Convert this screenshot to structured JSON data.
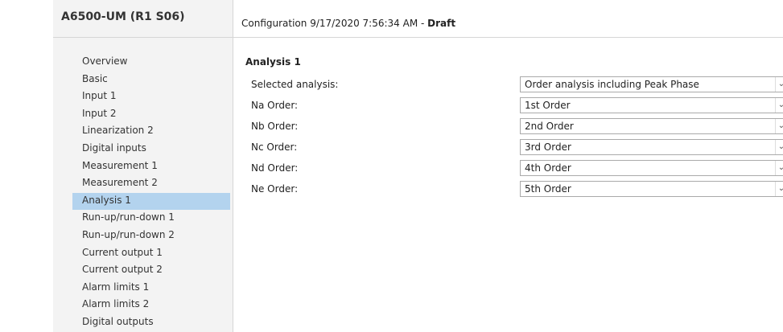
{
  "device": {
    "title": "A6500-UM (R1 S06)"
  },
  "header": {
    "prefix": "Configuration 9/17/2020 7:56:34 AM - ",
    "status": "Draft"
  },
  "nav": {
    "items": [
      {
        "label": "Overview"
      },
      {
        "label": "Basic"
      },
      {
        "label": "Input 1"
      },
      {
        "label": "Input 2"
      },
      {
        "label": "Linearization 2"
      },
      {
        "label": "Digital inputs"
      },
      {
        "label": "Measurement 1"
      },
      {
        "label": "Measurement 2"
      },
      {
        "label": "Analysis 1",
        "active": true
      },
      {
        "label": "Run-up/run-down 1"
      },
      {
        "label": "Run-up/run-down 2"
      },
      {
        "label": "Current output 1"
      },
      {
        "label": "Current output 2"
      },
      {
        "label": "Alarm limits 1"
      },
      {
        "label": "Alarm limits 2"
      },
      {
        "label": "Digital outputs"
      }
    ]
  },
  "main": {
    "section_title": "Analysis 1",
    "fields": [
      {
        "label": "Selected analysis:",
        "value": "Order analysis including Peak Phase"
      },
      {
        "label": "Na Order:",
        "value": "1st Order"
      },
      {
        "label": "Nb Order:",
        "value": "2nd Order"
      },
      {
        "label": "Nc Order:",
        "value": "3rd Order"
      },
      {
        "label": "Nd Order:",
        "value": "4th Order"
      },
      {
        "label": "Ne Order:",
        "value": "5th Order"
      }
    ]
  },
  "colors": {
    "active_nav": "#b3d3ee",
    "sidebar_bg": "#f3f3f3"
  },
  "icons": {
    "dropdown": "chevron-down-icon"
  }
}
